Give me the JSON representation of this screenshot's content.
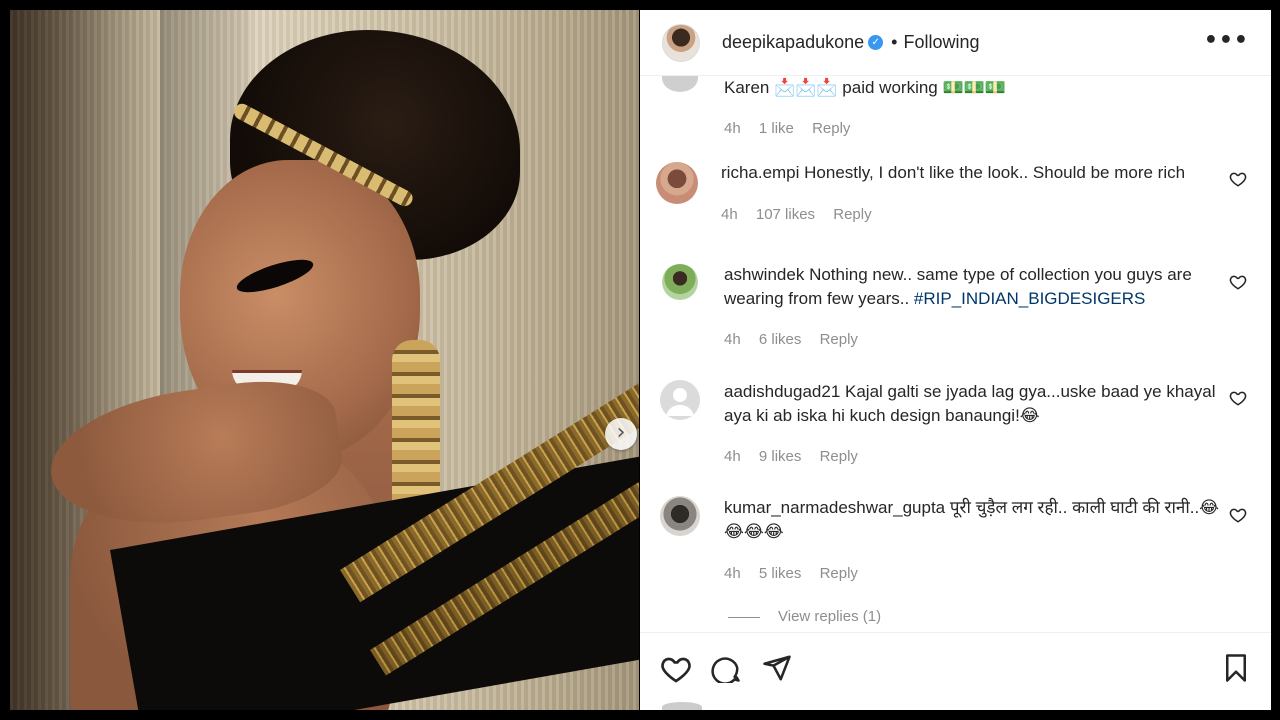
{
  "post": {
    "username": "deepikapadukone",
    "verified_badge": "✓",
    "separator": "•",
    "follow_status": "Following",
    "more_label": "•••",
    "carousel_next": "›"
  },
  "comments": [
    {
      "username": "",
      "text": "Karen 📩📩📩 paid working 💵💵💵",
      "time": "4h",
      "likes": "1 like",
      "reply_label": "Reply"
    },
    {
      "username": "richa.empi",
      "text": "Honestly, I don't like the look.. Should be more rich",
      "time": "4h",
      "likes": "107 likes",
      "reply_label": "Reply"
    },
    {
      "username": "ashwindek",
      "text": "Nothing new.. same type of collection you guys are wearing from few years..",
      "hashtag": "#RIP_INDIAN_BIGDESIGERS",
      "time": "4h",
      "likes": "6 likes",
      "reply_label": "Reply"
    },
    {
      "username": "aadishdugad21",
      "text": "Kajal galti se jyada lag gya...uske baad ye khayal aya ki ab iska hi kuch design banaungi!😂",
      "time": "4h",
      "likes": "9 likes",
      "reply_label": "Reply"
    },
    {
      "username": "kumar_narmadeshwar_gupta",
      "text": "पूरी चुड़ैल लग रही.. काली घाटी की रानी..😂😂😂😂",
      "time": "4h",
      "likes": "5 likes",
      "reply_label": "Reply"
    }
  ],
  "view_replies": "View replies (1)",
  "icons": {
    "like": "heart-icon",
    "comment": "comment-icon",
    "share": "send-icon",
    "save": "bookmark-icon"
  },
  "colors": {
    "link": "#00376b",
    "muted": "#8e8e8e",
    "verified": "#3897f0"
  }
}
